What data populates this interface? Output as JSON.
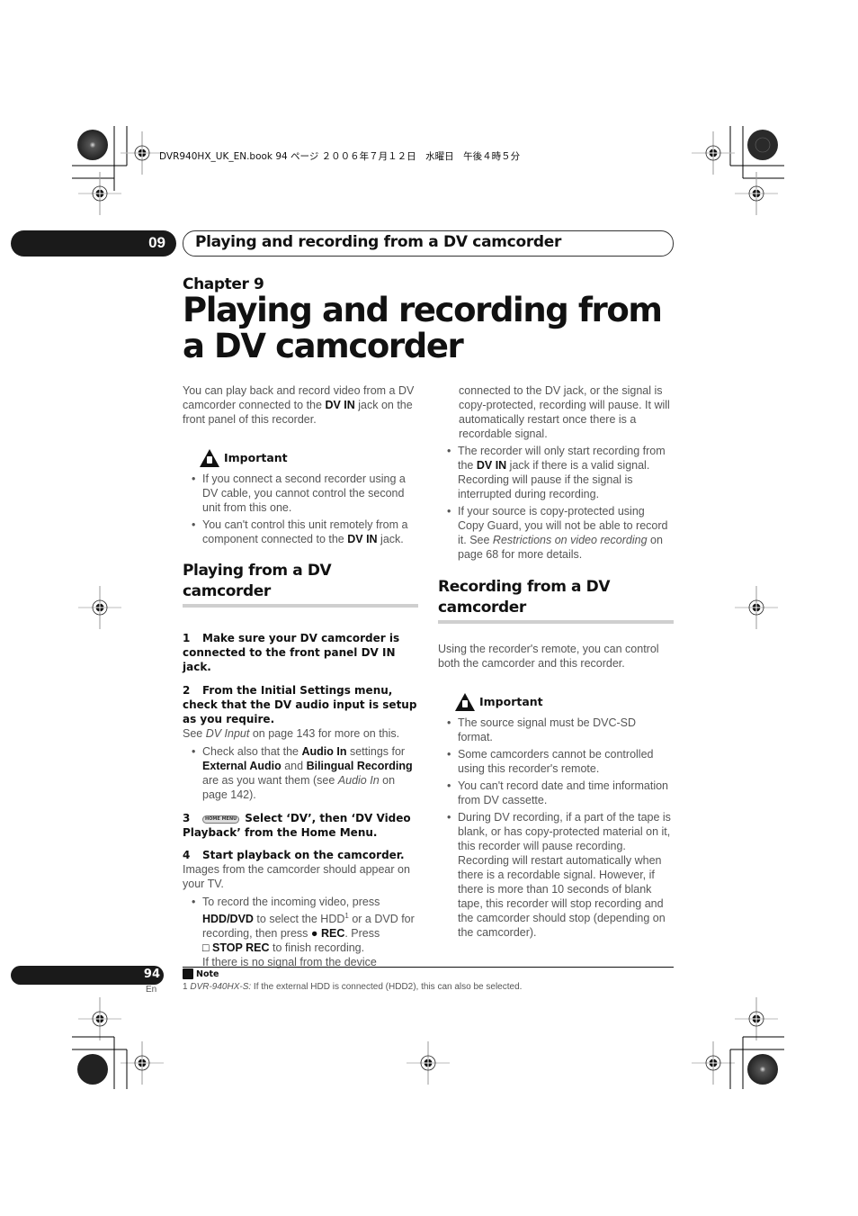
{
  "print_marks": {
    "book_line": "DVR940HX_UK_EN.book  94 ページ  ２００６年７月１２日　水曜日　午後４時５分"
  },
  "header": {
    "chapter_number": "09",
    "running_title": "Playing and recording from a DV camcorder"
  },
  "title_block": {
    "chapter_label": "Chapter 9",
    "title": "Playing and recording from a DV camcorder"
  },
  "left_column": {
    "intro": {
      "pre": "You can play back and record video from a DV camcorder connected to the ",
      "bold": "DV IN",
      "post": " jack on the front panel of this recorder."
    },
    "important_label": "Important",
    "important_items": [
      {
        "text": "If you connect a second recorder using a DV cable, you cannot control the second unit from this one."
      },
      {
        "pre": "You can't control this unit remotely from a component connected to the ",
        "bold": "DV IN",
        "post": " jack."
      }
    ],
    "section_title": "Playing from a DV camcorder",
    "steps": [
      {
        "num": "1",
        "text": "Make sure your DV camcorder is connected to the front panel DV IN jack."
      },
      {
        "num": "2",
        "text": "From the Initial Settings menu, check that the DV audio input is setup as you require."
      },
      {
        "num": "3",
        "button": "HOME MENU",
        "text": "Select ‘DV’, then ‘DV Video Playback’ from the Home Menu."
      },
      {
        "num": "4",
        "text": "Start playback on the camcorder."
      }
    ],
    "step2_body": {
      "pre": "See ",
      "italic": "DV Input",
      "post": " on page 143 for more on this."
    },
    "step2_bullet": {
      "t1": "Check also that the ",
      "b1": "Audio In",
      "t2": " settings for ",
      "b2": "External Audio",
      "t3": " and ",
      "b3": "Bilingual Recording",
      "t4": " are as you want them (see ",
      "i1": "Audio In",
      "t5": " on page 142)."
    },
    "step4_body": "Images from the camcorder should appear on your TV.",
    "step4_bullet": {
      "t1": "To record the incoming video, press ",
      "b1": "HDD/DVD",
      "t2": " to select the HDD",
      "sup": "1",
      "t3": " or a DVD for recording, then press ",
      "rec_symbol": "●",
      "b2": "REC",
      "t4": ". Press ",
      "stop_symbol": "□",
      "b3": "STOP REC",
      "t5": " to finish recording.",
      "t6": "If there is no signal from the device"
    }
  },
  "right_column": {
    "continuation": "connected to the DV jack, or the signal is copy-protected, recording will pause. It will automatically restart once there is a recordable signal.",
    "bullets": [
      {
        "pre": "The recorder will only start recording from the ",
        "bold": "DV IN",
        "post": " jack if there is a valid signal. Recording will pause if the signal is interrupted during recording."
      },
      {
        "pre": "If your source is copy-protected using Copy Guard, you will not be able to record it. See ",
        "italic": "Restrictions on video recording",
        "post": " on page 68 for more details."
      }
    ],
    "section_title": "Recording from a DV camcorder",
    "intro": "Using the recorder's remote, you can control both the camcorder and this recorder.",
    "important_label": "Important",
    "important_items": [
      "The source signal must be DVC-SD format.",
      "Some camcorders cannot be controlled using this recorder's remote.",
      "You can't record date and time information from DV cassette.",
      "During DV recording, if a part of the tape is blank, or has copy-protected material on it, this recorder will pause recording. Recording will restart automatically when there is a recordable signal. However, if there is more than 10 seconds of blank tape, this recorder will stop recording and the camcorder should stop (depending on the camcorder)."
    ]
  },
  "footer": {
    "page_number": "94",
    "language": "En",
    "note_label": "Note",
    "note_num": "1",
    "note_model": "DVR-940HX-S:",
    "note_text": " If the external HDD is connected (HDD2), this can also be selected."
  }
}
